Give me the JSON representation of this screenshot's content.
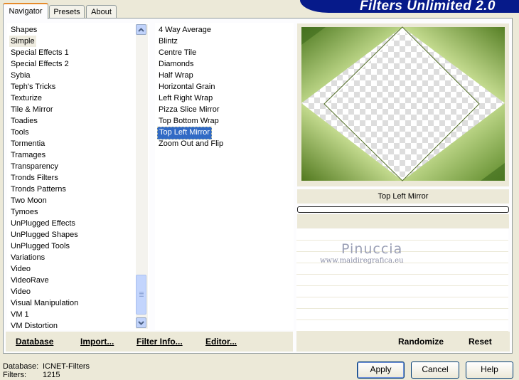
{
  "tabs": [
    {
      "label": "Navigator"
    },
    {
      "label": "Presets"
    },
    {
      "label": "About"
    }
  ],
  "header": {
    "title": "Filters Unlimited 2.0"
  },
  "categories": [
    "Shapes",
    "Simple",
    "Special Effects 1",
    "Special Effects 2",
    "Sybia",
    "Teph's Tricks",
    "Texturize",
    "Tile & Mirror",
    "Toadies",
    "Tools",
    "Tormentia",
    "Tramages",
    "Transparency",
    "Tronds Filters",
    "Tronds Patterns",
    "Two Moon",
    "Tymoes",
    "UnPlugged Effects",
    "UnPlugged Shapes",
    "UnPlugged Tools",
    "Variations",
    "Video",
    "VideoRave",
    "Video",
    "Visual Manipulation",
    "VM 1",
    "VM Distortion"
  ],
  "selected_category": "Simple",
  "filters": [
    "4 Way Average",
    "Blintz",
    "Centre Tile",
    "Diamonds",
    "Half Wrap",
    "Horizontal Grain",
    "Left Right Wrap",
    "Pizza Slice Mirror",
    "Top Bottom Wrap",
    "Top Left Mirror",
    "Zoom Out and Flip"
  ],
  "selected_filter": "Top Left Mirror",
  "preview": {
    "caption": "Top Left Mirror"
  },
  "watermark": {
    "name": "Pinuccia",
    "site": "www.maidiregrafica.eu"
  },
  "actions": {
    "database": "Database",
    "import": "Import...",
    "filter_info": "Filter Info...",
    "editor": "Editor...",
    "randomize": "Randomize",
    "reset": "Reset"
  },
  "status": {
    "database_label": "Database:",
    "database_value": "ICNET-Filters",
    "filters_label": "Filters:",
    "filters_value": "1215"
  },
  "buttons": {
    "apply": "Apply",
    "cancel": "Cancel",
    "help": "Help"
  },
  "colors": {
    "accent": "#316ac5",
    "header_bg": "#061a8a",
    "tab_highlight": "#e68b2c"
  }
}
